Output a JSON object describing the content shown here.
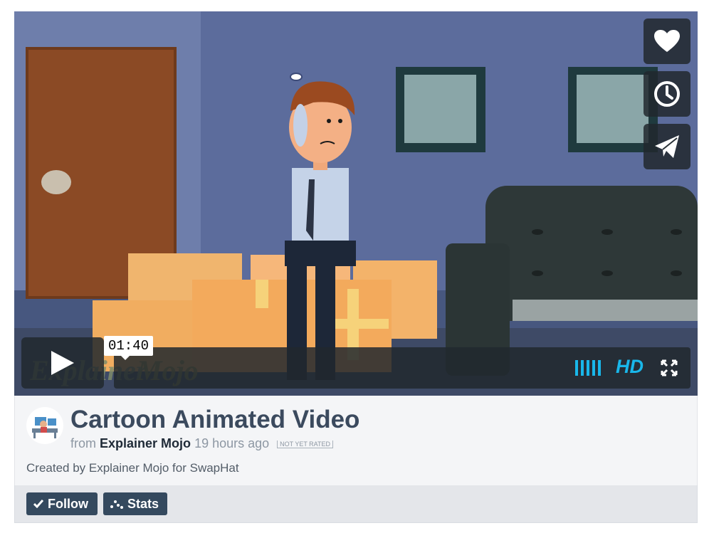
{
  "player": {
    "watermark": "ExplainerMojo",
    "time_tooltip": "01:40",
    "hd_label": "HD",
    "buttons": {
      "like_icon": "heart-icon",
      "later_icon": "clock-icon",
      "share_icon": "paper-plane-icon",
      "play_icon": "play-icon",
      "volume_icon": "volume-bars-icon",
      "fullscreen_icon": "fullscreen-icon"
    },
    "accent_color": "#19b7ea"
  },
  "video": {
    "title": "Cartoon Animated Video",
    "from_label": "from",
    "author": "Explainer Mojo",
    "time_ago": "19 hours ago",
    "rating": "NOT YET RATED",
    "description": "Created by Explainer Mojo for SwapHat"
  },
  "actions": {
    "follow_label": "Follow",
    "stats_label": "Stats"
  }
}
